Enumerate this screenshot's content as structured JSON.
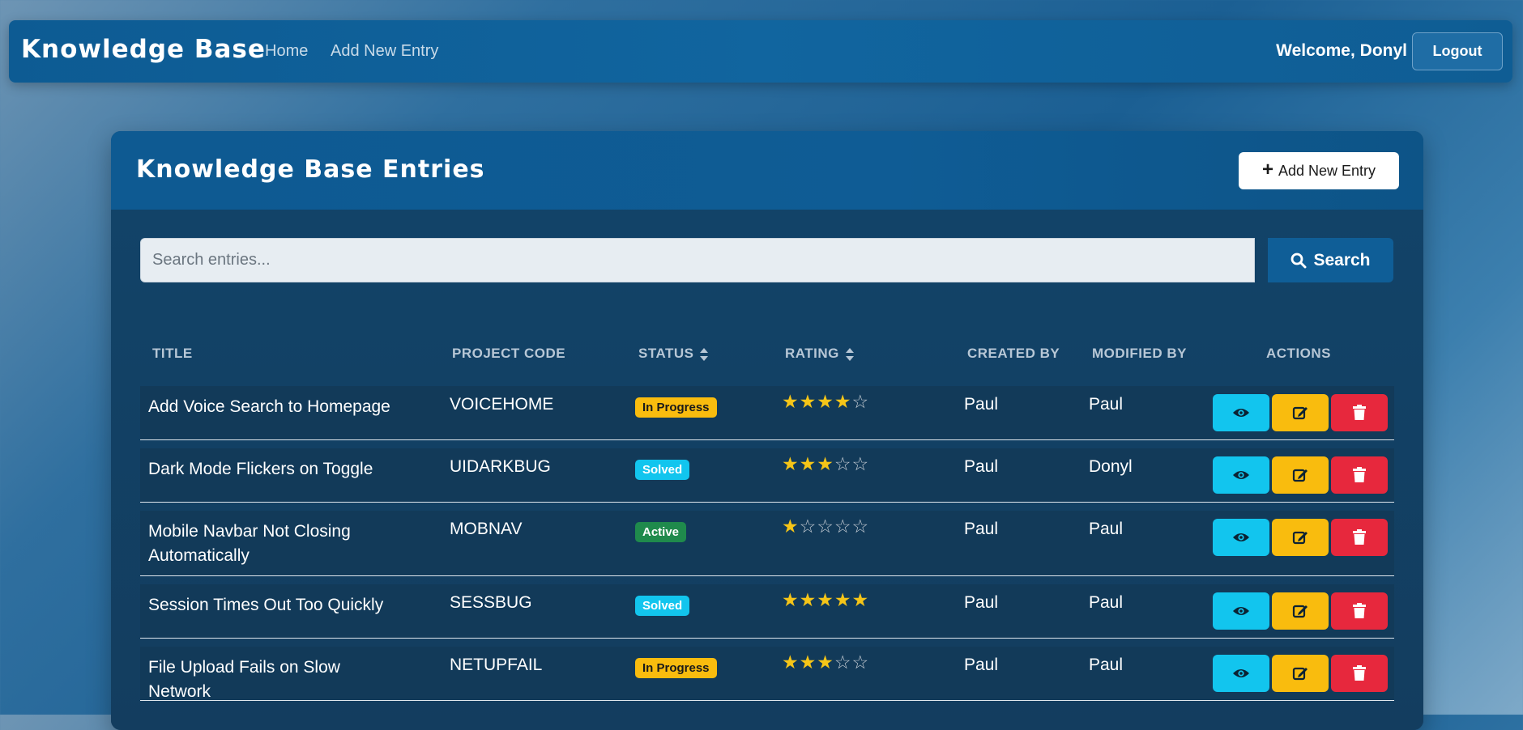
{
  "navbar": {
    "brand": "Knowledge Base",
    "links": [
      "Home",
      "Add New Entry"
    ],
    "welcome": "Welcome, Donyl",
    "logout_label": "Logout"
  },
  "page": {
    "title": "Knowledge Base Entries",
    "add_button_label": "Add New Entry",
    "search_placeholder": "Search entries...",
    "search_button_label": "Search"
  },
  "table": {
    "headers": [
      "TITLE",
      "PROJECT CODE",
      "STATUS",
      "RATING",
      "CREATED BY",
      "MODIFIED BY",
      "ACTIONS"
    ],
    "rows": [
      {
        "title": "Add Voice Search to Homepage",
        "code": "VOICEHOME",
        "status": "In Progress",
        "rating": 4,
        "created_by": "Paul",
        "modified_by": "Paul"
      },
      {
        "title": "Dark Mode Flickers on Toggle",
        "code": "UIDARKBUG",
        "status": "Solved",
        "rating": 3,
        "created_by": "Paul",
        "modified_by": "Donyl"
      },
      {
        "title": "Mobile Navbar Not Closing Automatically",
        "code": "MOBNAV",
        "status": "Active",
        "rating": 1,
        "created_by": "Paul",
        "modified_by": "Paul"
      },
      {
        "title": "Session Times Out Too Quickly",
        "code": "SESSBUG",
        "status": "Solved",
        "rating": 5,
        "created_by": "Paul",
        "modified_by": "Paul"
      },
      {
        "title": "File Upload Fails on Slow Network",
        "code": "NETUPFAIL",
        "status": "In Progress",
        "rating": 3,
        "created_by": "Paul",
        "modified_by": "Paul"
      }
    ]
  },
  "status_colors": {
    "In Progress": {
      "bg": "#f9bc0e",
      "fg": "#1a1a1a"
    },
    "Solved": {
      "bg": "#12c5ee",
      "fg": "#ffffff"
    },
    "Active": {
      "bg": "#1f8a4c",
      "fg": "#ffffff"
    }
  },
  "icons": {
    "view": "eye-icon",
    "edit": "edit-icon",
    "delete": "trash-icon",
    "search": "search-icon",
    "add": "plus-icon",
    "sort": "sort-icon"
  }
}
